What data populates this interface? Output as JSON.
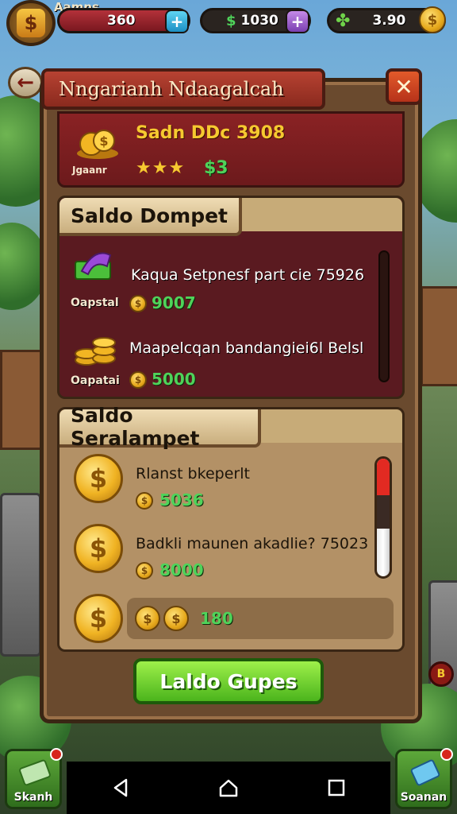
{
  "hud": {
    "player_name": "Aamns",
    "gems_value": "360",
    "cash_value": "1030",
    "coins_value": "3.90",
    "icons": [
      "avatar-dollar-icon",
      "plus-icon",
      "cash-icon",
      "plus-icon",
      "clover-icon",
      "coin-icon"
    ]
  },
  "panel": {
    "title": "Nngarianh Ndaagalcah",
    "close_label": "✕",
    "back_label": "←"
  },
  "reward": {
    "title": "Sadn DDc 3908",
    "caption": "Jgaanr",
    "stars": "★★★",
    "amount": "$3"
  },
  "wallet": {
    "heading": "Saldo Dompet",
    "rows": [
      {
        "caption": "Oapstal",
        "title": "Kaqua Setpnesf part cie 75926",
        "value": "9007"
      },
      {
        "caption": "Oapatai",
        "title": "Maapelcqan bandangiei6l Belsl",
        "value": "5000"
      }
    ]
  },
  "saving": {
    "heading": "Saldo Seralampet",
    "rows": [
      {
        "title": "Rlanst bkeperlt",
        "value": "5036"
      },
      {
        "title": "Badkli maunen akadlie? 75023",
        "value": "8000"
      }
    ],
    "bonus_value": "180",
    "slider_level": 0.3
  },
  "cta_label": "Laldo Gupes",
  "side_badge": "B",
  "bottom": {
    "left_label": "Skanh",
    "right_label": "Soanan"
  },
  "colors": {
    "accent_green": "#4fd35a",
    "gold": "#f6c930",
    "title_red": "#b74232"
  }
}
